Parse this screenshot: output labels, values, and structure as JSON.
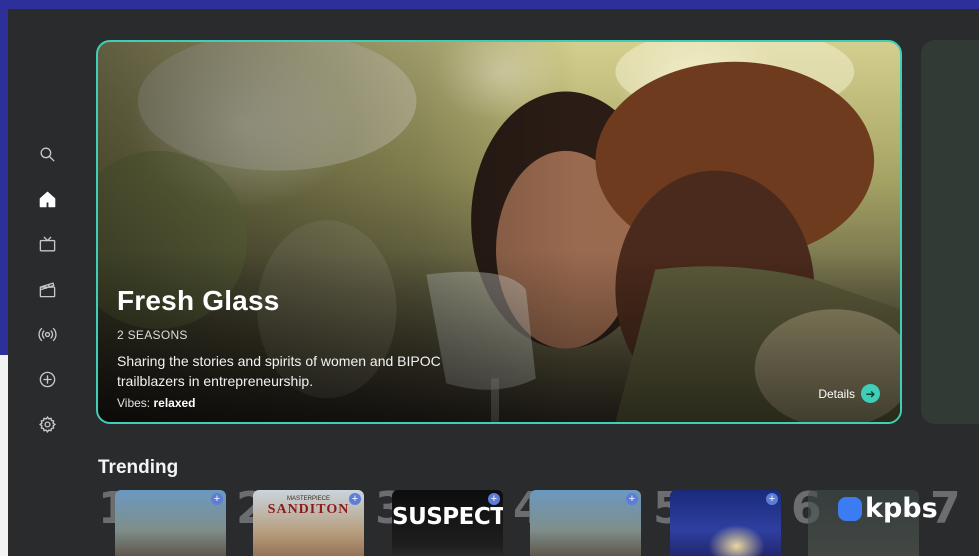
{
  "colors": {
    "frame": "#2d2f9b",
    "app_bg": "#292b2c",
    "accent": "#3fcfb8",
    "logo_blue": "#3b7cf2"
  },
  "sidebar": {
    "items": [
      {
        "icon": "search-icon"
      },
      {
        "icon": "home-icon",
        "active": true
      },
      {
        "icon": "tv-icon"
      },
      {
        "icon": "clapperboard-icon"
      },
      {
        "icon": "broadcast-icon"
      },
      {
        "icon": "add-circle-icon"
      },
      {
        "icon": "gear-icon"
      }
    ]
  },
  "hero": {
    "title": "Fresh Glass",
    "seasons": "2 SEASONS",
    "description": "Sharing the stories and spirits of women and BIPOC trailblazers in entrepreneurship.",
    "vibes_label": "Vibes:",
    "vibes_value": "relaxed",
    "details_label": "Details"
  },
  "trending": {
    "title": "Trending",
    "items": [
      {
        "rank": "1",
        "poster_text": ""
      },
      {
        "rank": "2",
        "poster_text": "SANDITON",
        "poster_subtext": "MASTERPIECE"
      },
      {
        "rank": "3",
        "poster_text": "SUSPECTS"
      },
      {
        "rank": "4",
        "poster_text": ""
      },
      {
        "rank": "5",
        "poster_text": ""
      },
      {
        "rank": "6",
        "poster_text": ""
      },
      {
        "rank": "7",
        "poster_text": ""
      }
    ]
  },
  "logo": {
    "text": "kpbs"
  }
}
